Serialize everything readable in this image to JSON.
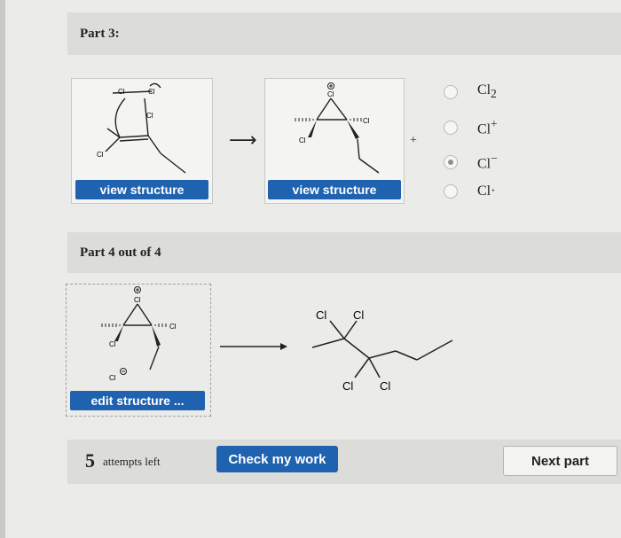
{
  "part3": {
    "title": "Part 3:",
    "view_button_1": "view structure",
    "view_button_2": "view structure",
    "plus": "+",
    "options": [
      {
        "symbol": "Cl",
        "sub": "2",
        "sup": "",
        "selected": false
      },
      {
        "symbol": "Cl",
        "sub": "",
        "sup": "+",
        "selected": false
      },
      {
        "symbol": "Cl",
        "sub": "",
        "sup": "−",
        "selected": true
      },
      {
        "symbol": "Cl·",
        "sub": "",
        "sup": "",
        "selected": false
      }
    ],
    "reactant_labels": {
      "cl_a": "Cl",
      "cl_b": "Cl",
      "cl_c": "Cl",
      "cl_d": "Cl"
    },
    "intermediate_labels": {
      "cl_top": "Cl",
      "cl_right": "Cl",
      "cl_left": "Cl"
    }
  },
  "part4": {
    "title": "Part 4 out of 4",
    "edit_button": "edit structure ...",
    "bromonium_labels": {
      "cl_top": "Cl",
      "cl_right": "Cl",
      "cl_left": "Cl",
      "chloride": "Cl"
    },
    "product_labels": {
      "cl1": "Cl",
      "cl2": "Cl",
      "cl3": "Cl",
      "cl4": "Cl"
    }
  },
  "footer": {
    "attempts_count": "5",
    "attempts_text": "attempts left",
    "check_button": "Check my work",
    "next_button": "Next part"
  }
}
